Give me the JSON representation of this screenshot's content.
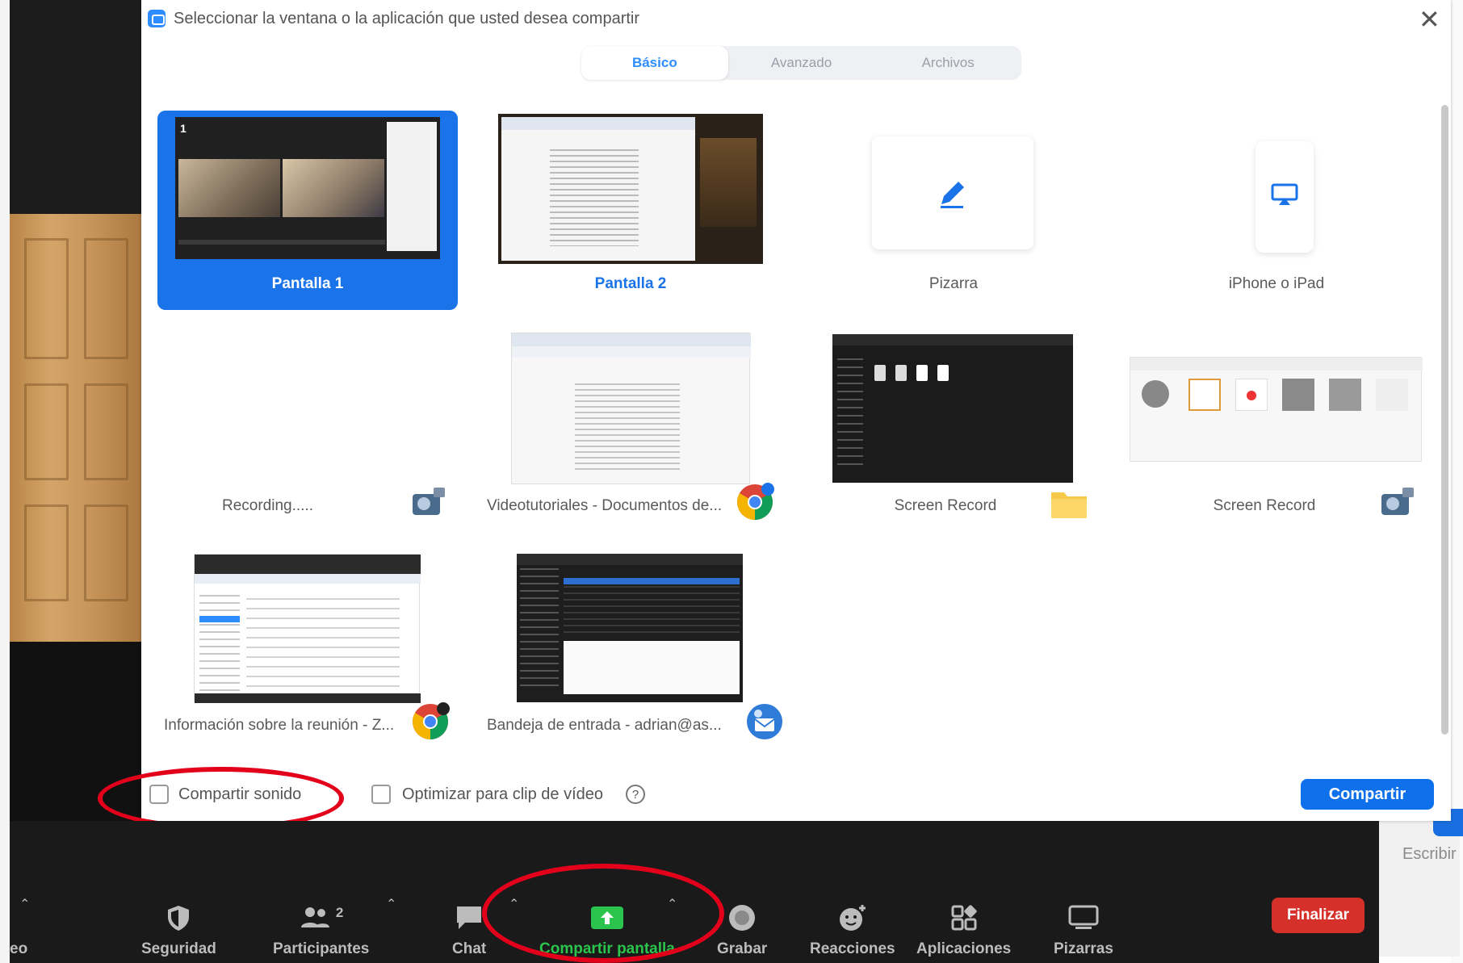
{
  "dialog": {
    "title": "Seleccionar la ventana o la aplicación que usted desea compartir",
    "close_icon": "close-icon",
    "tabs": [
      {
        "label": "Básico",
        "active": true
      },
      {
        "label": "Avanzado",
        "active": false
      },
      {
        "label": "Archivos",
        "active": false
      }
    ],
    "tiles": [
      {
        "label": "Pantalla 1",
        "selected": true
      },
      {
        "label": "Pantalla 2",
        "selected": false
      },
      {
        "label": "Pizarra",
        "icon": "pencil-icon"
      },
      {
        "label": "iPhone o iPad",
        "icon": "airplay-icon"
      },
      {
        "label": "Recording.....",
        "app_icon": "screen-recorder-icon"
      },
      {
        "label": "Videotutoriales - Documentos de...",
        "app_icon": "chrome-icon"
      },
      {
        "label": "Screen Record",
        "app_icon": "folder-icon"
      },
      {
        "label": "Screen Record",
        "app_icon": "screen-recorder-icon"
      },
      {
        "label": "Información sobre la reunión - Z...",
        "app_icon": "chrome-icon"
      },
      {
        "label": "Bandeja de entrada - adrian@as...",
        "app_icon": "thunderbird-icon"
      }
    ],
    "share_sound_label": "Compartir sonido",
    "optimize_label": "Optimizar para clip de vídeo",
    "help_icon": "?",
    "share_button": "Compartir"
  },
  "toolbar": {
    "left_partial_label": "eo",
    "items": [
      {
        "label": "Seguridad",
        "icon": "shield-icon"
      },
      {
        "label": "Participantes",
        "icon": "participants-icon",
        "count": "2"
      },
      {
        "label": "Chat",
        "icon": "chat-icon"
      },
      {
        "label": "Compartir pantalla",
        "icon": "share-screen-icon",
        "color": "#2bc44c"
      },
      {
        "label": "Grabar",
        "icon": "record-icon"
      },
      {
        "label": "Reacciones",
        "icon": "reactions-icon"
      },
      {
        "label": "Aplicaciones",
        "icon": "apps-icon"
      },
      {
        "label": "Pizarras",
        "icon": "whiteboard-icon"
      }
    ],
    "end_button": "Finalizar",
    "end_button_color": "#d6302a"
  },
  "side_panel": {
    "partial_text": "Escribir"
  },
  "colors": {
    "accent": "#0e71eb",
    "annotation": "#e3001b"
  }
}
